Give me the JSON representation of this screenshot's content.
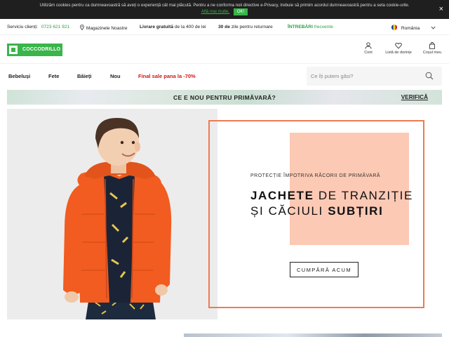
{
  "cookie_bar": {
    "text": "Utilizăm cookies pentru ca dumneavoastră să aveți o experiență cât mai plăcută. Pentru a ne conforma noii directive e-Privacy, trebuie să primim acordul dumneavoastră pentru a seta cookie-urile.",
    "more_link": "Află mai multe.",
    "ok_label": "OK!",
    "close_label": "×"
  },
  "infobar": {
    "service_label": "Serviciu clienți:",
    "service_phone": "0723 621 921",
    "stores_label": "Magazinele Noastre",
    "free_delivery_bold": "Livrare gratuită",
    "free_delivery_rest": "de la 400 de lei",
    "returns_bold": "30 de",
    "returns_rest": "zile pentru returnare",
    "faq_bold": "ÎNTREBĂRI",
    "faq_rest": "frecvente",
    "country": "România"
  },
  "header": {
    "logo_text": "COCCODRILLO",
    "account_label": "Cont",
    "wishlist_label": "Listă de dorințe",
    "cart_label": "Coșul meu"
  },
  "nav": {
    "items": [
      "Bebeluși",
      "Fete",
      "Băieți",
      "Nou"
    ],
    "sale": "Final sale pana la -70%"
  },
  "search": {
    "placeholder": "Ce îți putem găsi?"
  },
  "promo": {
    "text": "CE E NOU PENTRU PRIMĂVARĂ?",
    "link": "VERIFICĂ"
  },
  "hero": {
    "eyebrow": "PROTECȚIE ÎMPOTRIVA RĂCORII DE PRIMĂVARĂ",
    "line1_bold": "JACHETE",
    "line1_rest": " DE TRANZIȚIE",
    "line2_rest": "ȘI CĂCIULI ",
    "line2_bold": "SUBȚIRI",
    "cta": "CUMPĂRĂ ACUM"
  },
  "colors": {
    "brand_green": "#39b54a",
    "sale_red": "#d01717",
    "hero_border": "#ee7b51",
    "hero_peach": "#fcc9b5"
  },
  "icons": [
    "map-pin-icon",
    "romania-flag-icon",
    "chevron-down-icon",
    "user-icon",
    "heart-icon",
    "shopping-bag-icon",
    "search-icon",
    "close-icon"
  ]
}
